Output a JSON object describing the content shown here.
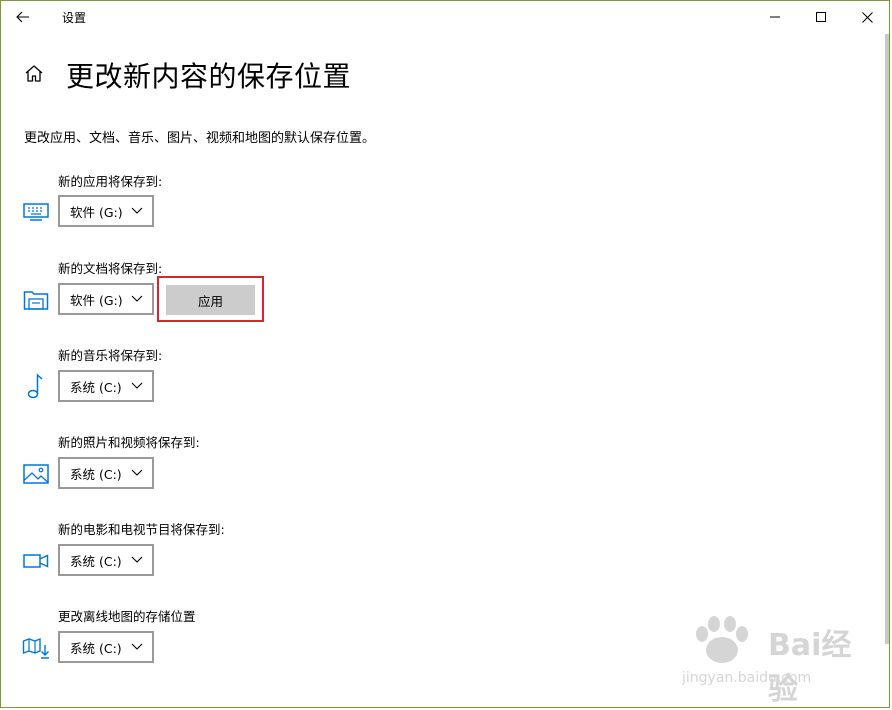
{
  "window": {
    "app_title": "设置"
  },
  "page": {
    "title": "更改新内容的保存位置",
    "description": "更改应用、文档、音乐、图片、视频和地图的默认保存位置。"
  },
  "sections": [
    {
      "label": "新的应用将保存到:",
      "icon": "monitor-icon",
      "value": "软件 (G:)"
    },
    {
      "label": "新的文档将保存到:",
      "icon": "folder-drive-icon",
      "value": "软件 (G:)"
    },
    {
      "label": "新的音乐将保存到:",
      "icon": "music-note-icon",
      "value": "系统 (C:)"
    },
    {
      "label": "新的照片和视频将保存到:",
      "icon": "photo-icon",
      "value": "系统 (C:)"
    },
    {
      "label": "新的电影和电视节目将保存到:",
      "icon": "video-camera-icon",
      "value": "系统 (C:)"
    },
    {
      "label": "更改离线地图的存储位置",
      "icon": "map-download-icon",
      "value": "系统 (C:)"
    }
  ],
  "apply_button": {
    "label": "应用",
    "highlight_color": "#d9262e"
  },
  "watermark": {
    "brand": "Bai经验",
    "url": "jingyan.baidu.com"
  },
  "colors": {
    "accent": "#0078d7",
    "button_bg": "#cccccc",
    "dropdown_border": "#999999"
  }
}
